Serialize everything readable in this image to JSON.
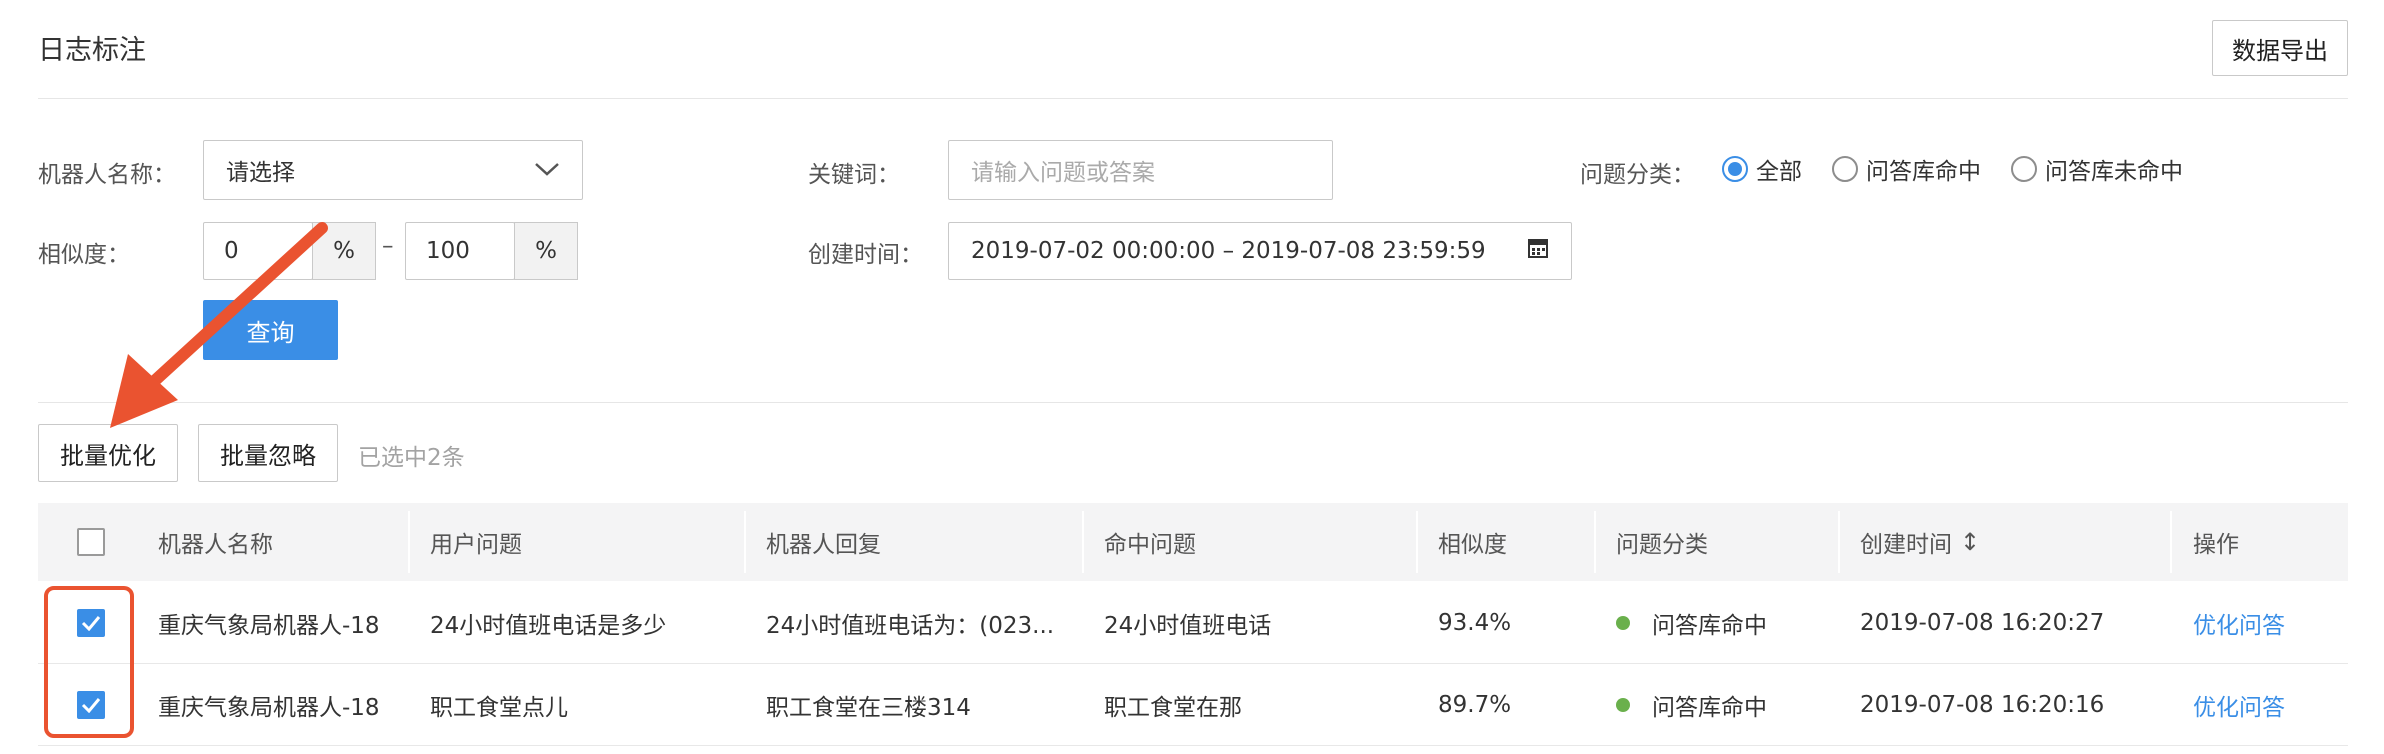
{
  "header": {
    "title": "日志标注",
    "export_label": "数据导出"
  },
  "filters": {
    "robot_label": "机器人名称：",
    "robot_value": "请选择",
    "keyword_label": "关键词：",
    "keyword_placeholder": "请输入问题或答案",
    "category_label": "问题分类：",
    "category_options": [
      "全部",
      "问答库命中",
      "问答库未命中"
    ],
    "category_selected": "全部",
    "similarity_label": "相似度：",
    "similarity_min": "0",
    "similarity_max": "100",
    "percent": "%",
    "range_sep": "–",
    "time_label": "创建时间：",
    "time_value": "2019-07-02 00:00:00 – 2019-07-08 23:59:59",
    "query_label": "查询"
  },
  "actions": {
    "batch_optimize": "批量优化",
    "batch_ignore": "批量忽略",
    "selected_text": "已选中2条"
  },
  "table": {
    "columns": [
      "机器人名称",
      "用户问题",
      "机器人回复",
      "命中问题",
      "相似度",
      "问题分类",
      "创建时间",
      "操作"
    ],
    "sort_icon": "↕",
    "rows": [
      {
        "checked": true,
        "robot": "重庆气象局机器人-18",
        "question": "24小时值班电话是多少",
        "reply": "24小时值班电话为：(023...",
        "hit": "24小时值班电话",
        "similarity": "93.4%",
        "category": "问答库命中",
        "time": "2019-07-08 16:20:27",
        "action": "优化问答"
      },
      {
        "checked": true,
        "robot": "重庆气象局机器人-18",
        "question": "职工食堂点儿",
        "reply": "职工食堂在三楼314",
        "hit": "职工食堂在那",
        "similarity": "89.7%",
        "category": "问答库命中",
        "time": "2019-07-08 16:20:16",
        "action": "优化问答"
      }
    ]
  },
  "colors": {
    "accent": "#3a8ee6",
    "annotation": "#ea5330",
    "status_ok": "#6ab04c"
  }
}
